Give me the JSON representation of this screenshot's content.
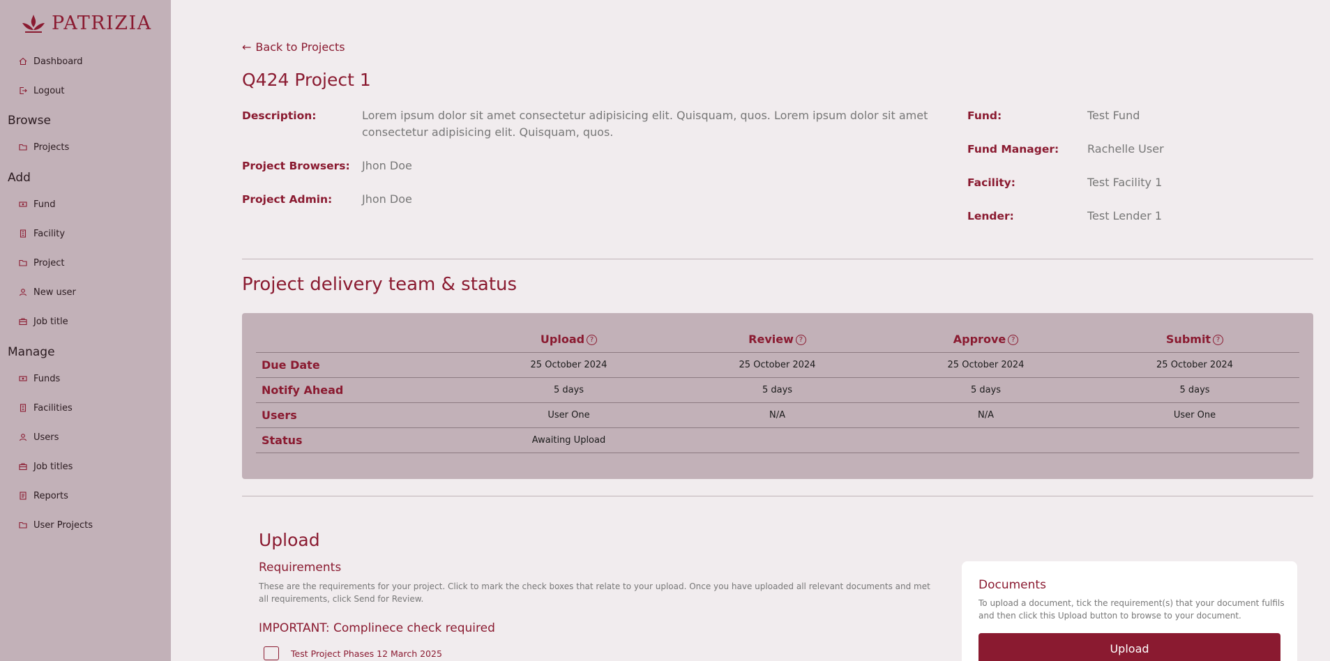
{
  "brand": {
    "name": "PATRIZIA"
  },
  "sidebar": {
    "top": [
      {
        "label": "Dashboard",
        "icon": "home-icon"
      },
      {
        "label": "Logout",
        "icon": "logout-icon"
      }
    ],
    "browse": {
      "heading": "Browse",
      "items": [
        {
          "label": "Projects",
          "icon": "folder-icon"
        }
      ]
    },
    "add": {
      "heading": "Add",
      "items": [
        {
          "label": "Fund",
          "icon": "money-icon"
        },
        {
          "label": "Facility",
          "icon": "building-icon"
        },
        {
          "label": "Project",
          "icon": "folder-icon"
        },
        {
          "label": "New user",
          "icon": "user-icon"
        },
        {
          "label": "Job title",
          "icon": "briefcase-icon"
        }
      ]
    },
    "manage": {
      "heading": "Manage",
      "items": [
        {
          "label": "Funds",
          "icon": "money-icon"
        },
        {
          "label": "Facilities",
          "icon": "building-icon"
        },
        {
          "label": "Users",
          "icon": "user-icon"
        },
        {
          "label": "Job titles",
          "icon": "briefcase-icon"
        },
        {
          "label": "Reports",
          "icon": "report-icon"
        },
        {
          "label": "User Projects",
          "icon": "folder-icon"
        }
      ]
    }
  },
  "back_link": "Back to Projects",
  "project": {
    "title": "Q424 Project 1",
    "description_label": "Description:",
    "description": "Lorem ipsum dolor sit amet consectetur adipisicing elit. Quisquam, quos. Lorem ipsum dolor sit amet consectetur adipisicing elit. Quisquam, quos.",
    "browsers_label": "Project Browsers:",
    "browsers": "Jhon Doe",
    "admin_label": "Project Admin:",
    "admin": "Jhon Doe",
    "fund_label": "Fund:",
    "fund": "Test Fund",
    "fund_manager_label": "Fund Manager:",
    "fund_manager": "Rachelle User",
    "facility_label": "Facility:",
    "facility": "Test Facility 1",
    "lender_label": "Lender:",
    "lender": "Test Lender 1"
  },
  "delivery": {
    "title": "Project delivery team & status",
    "columns": [
      "Upload",
      "Review",
      "Approve",
      "Submit"
    ],
    "rows": [
      {
        "label": "Due Date",
        "cells": [
          "25 October 2024",
          "25 October 2024",
          "25 October 2024",
          "25 October 2024"
        ]
      },
      {
        "label": "Notify Ahead",
        "cells": [
          "5 days",
          "5 days",
          "5 days",
          "5 days"
        ]
      },
      {
        "label": "Users",
        "cells": [
          "User One",
          "N/A",
          "N/A",
          "User One"
        ]
      },
      {
        "label": "Status",
        "cells": [
          "Awaiting Upload",
          "",
          "",
          ""
        ]
      }
    ],
    "help_glyph": "?"
  },
  "upload": {
    "title": "Upload",
    "requirements_title": "Requirements",
    "requirements_desc": "These are the requirements for your project. Click to mark the check boxes that relate to your upload. Once you have uploaded all relevant documents and met all requirements, click Send for Review.",
    "important": "IMPORTANT: Complinece check required",
    "checkbox_label": "Test Project Phases 12 March 2025"
  },
  "documents": {
    "title": "Documents",
    "desc": "To upload a document, tick the requirement(s) that your document fulfils and then click this Upload button to browse to your document.",
    "button": "Upload"
  },
  "colors": {
    "accent": "#8a1a30",
    "sidebar": "#c2b1b8",
    "background": "#f1ecee"
  }
}
